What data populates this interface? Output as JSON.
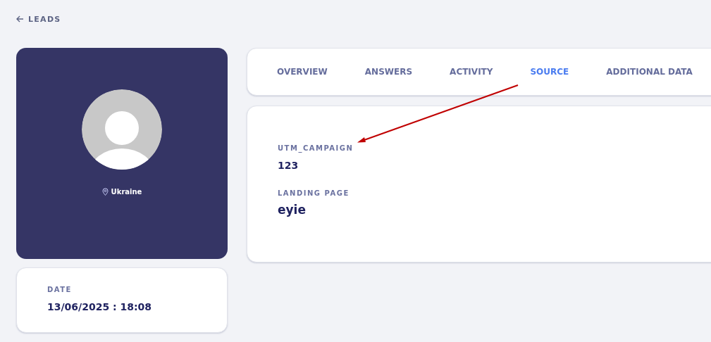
{
  "back_link": {
    "label": "LEADS"
  },
  "profile": {
    "kind": "picture",
    "location": "Ukraine"
  },
  "date_card": {
    "label": "DATE",
    "value": "13/06/2025 : 18:08"
  },
  "tabs": [
    {
      "label": "OVERVIEW",
      "selected": false
    },
    {
      "label": "ANSWERS",
      "selected": false
    },
    {
      "label": "ACTIVITY",
      "selected": false
    },
    {
      "label": "SOURCE",
      "selected": true
    },
    {
      "label": "ADDITIONAL DATA",
      "selected": false
    }
  ],
  "fields": [
    {
      "label": "UTM_CAMPAIGN",
      "value": "123"
    },
    {
      "label": "LANDING PAGE",
      "value": "eyie"
    }
  ],
  "annotation": {
    "kind": "arrow",
    "color": "#c00000"
  }
}
